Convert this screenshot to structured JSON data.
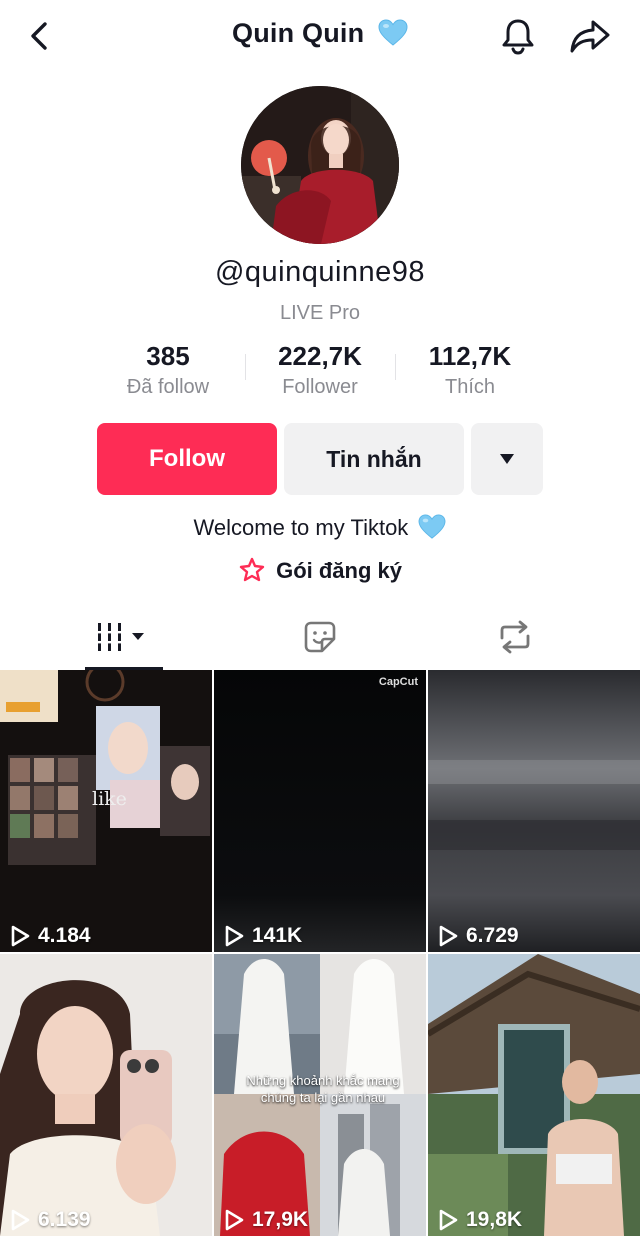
{
  "header": {
    "title": "Quin Quin",
    "title_emoji": "blue-heart-icon"
  },
  "profile": {
    "username": "@quinquinne98",
    "badge": "LIVE Pro",
    "stats": [
      {
        "value": "385",
        "label": "Đã follow"
      },
      {
        "value": "222,7K",
        "label": "Follower"
      },
      {
        "value": "112,7K",
        "label": "Thích"
      }
    ],
    "bio": "Welcome to my Tiktok",
    "subscription": "Gói đăng ký"
  },
  "actions": {
    "follow": "Follow",
    "message": "Tin nhắn"
  },
  "tabs": [
    "videos-grid-icon",
    "favorites-icon",
    "reposts-icon"
  ],
  "videos": [
    {
      "views": "4.184",
      "overlay_text": "like"
    },
    {
      "views": "141K",
      "overlay_text": "CapCut"
    },
    {
      "views": "6.729"
    },
    {
      "views": "6.139"
    },
    {
      "views": "17,9K",
      "overlay_text": "Những khoảnh khắc mang chúng ta lại gần nhau"
    },
    {
      "views": "19,8K"
    }
  ],
  "colors": {
    "accent": "#fe2c55",
    "secondary_button": "#f1f1f2",
    "muted_text": "#8a8b91"
  }
}
